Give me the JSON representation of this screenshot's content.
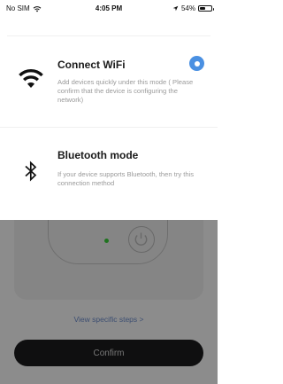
{
  "status_bar": {
    "carrier": "No SIM",
    "time": "4:05 PM",
    "battery": "54%",
    "battery_level": 0.54
  },
  "sheet": {
    "options": [
      {
        "title": "Connect WiFi",
        "description": "Add devices quickly under this mode ( Please confirm that the device is configuring the network)",
        "icon": "wifi-icon",
        "selected": true
      },
      {
        "title": "Bluetooth mode",
        "description": "If your device supports Bluetooth, then try this connection method",
        "icon": "bluetooth-icon",
        "selected": false
      }
    ]
  },
  "background": {
    "view_steps": "View specific steps >",
    "confirm_label": "Confirm"
  },
  "colors": {
    "accent": "#4a90e2",
    "confirm_bg": "#1c1c1e",
    "link": "#6f8fcf",
    "overlay": "rgba(0,0,0,0.45)"
  }
}
